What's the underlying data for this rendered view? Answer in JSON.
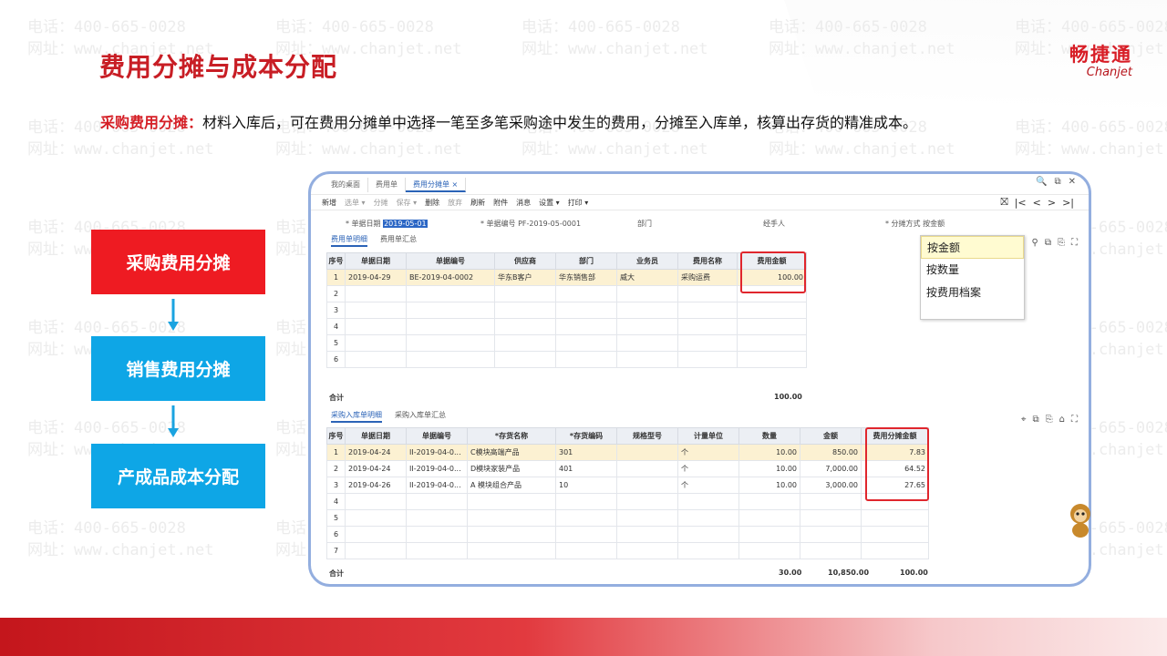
{
  "watermark": {
    "phone": "电话：400-665-0028",
    "site": "网址：www.chanjet.net"
  },
  "title": "费用分摊与成本分配",
  "logo": {
    "cn": "畅捷通",
    "en": "Chanjet"
  },
  "intro": {
    "label": "采购费用分摊：",
    "text": "材料入库后，可在费用分摊单中选择一笔至多笔采购途中发生的费用，分摊至入库单，核算出存货的精准成本。"
  },
  "flow": {
    "steps": [
      "采购费用分摊",
      "销售费用分摊",
      "产成品成本分配"
    ],
    "colors": [
      "#ee1b22",
      "#0ea6e6",
      "#0ea6e6"
    ]
  },
  "window": {
    "tabs": [
      "我的桌面",
      "费用单",
      "费用分摊单"
    ],
    "tab_close": "×",
    "toolbar": [
      {
        "label": "新增",
        "dim": false
      },
      {
        "label": "选单 ▾",
        "dim": true
      },
      {
        "label": "分摊",
        "dim": true
      },
      {
        "label": "保存 ▾",
        "dim": true
      },
      {
        "label": "删除",
        "dim": false
      },
      {
        "label": "放弃",
        "dim": true
      },
      {
        "label": "刷新",
        "dim": false
      },
      {
        "label": "附件",
        "dim": false
      },
      {
        "label": "消息",
        "dim": false
      },
      {
        "label": "设置 ▾",
        "dim": false
      },
      {
        "label": "打印 ▾",
        "dim": false
      }
    ],
    "nav_icons": [
      "⛝",
      "|<",
      "<",
      ">",
      ">|"
    ],
    "window_icons": [
      "🔍",
      "⧉",
      "✕"
    ],
    "form": {
      "date_label": "* 单据日期",
      "date_value": "2019-05-01",
      "code_label": "* 单据编号",
      "code_value": "PF-2019-05-0001",
      "dept_label": "部门",
      "handler_label": "经手人",
      "method_label": "* 分摊方式",
      "method_value": "按金额"
    },
    "top_subtabs": [
      "费用单明细",
      "费用单汇总"
    ],
    "expense_table": {
      "headers": [
        "序号",
        "单据日期",
        "单据编号",
        "供应商",
        "部门",
        "业务员",
        "费用名称",
        "费用金额"
      ],
      "rows": [
        [
          "1",
          "2019-04-29",
          "BE-2019-04-0002",
          "华东B客户",
          "华东销售部",
          "威大",
          "采购运费",
          "100.00"
        ]
      ],
      "empty_rows": [
        "2",
        "3",
        "4",
        "5",
        "6"
      ],
      "sum_label": "合计",
      "sum_value": "100.00"
    },
    "dropdown": [
      "按金额",
      "按数量",
      "按费用档案"
    ],
    "bottom_subtabs": [
      "采购入库单明细",
      "采购入库单汇总"
    ],
    "receipt_table": {
      "headers": [
        "序号",
        "单据日期",
        "单据编号",
        "*存货名称",
        "*存货编码",
        "规格型号",
        "计量单位",
        "数量",
        "金额",
        "费用分摊金额"
      ],
      "rows": [
        [
          "1",
          "2019-04-24",
          "II-2019-04-0...",
          "C模块高端产品",
          "301",
          "",
          "个",
          "10.00",
          "850.00",
          "7.83"
        ],
        [
          "2",
          "2019-04-24",
          "II-2019-04-0...",
          "D模块家装产品",
          "401",
          "",
          "个",
          "10.00",
          "7,000.00",
          "64.52"
        ],
        [
          "3",
          "2019-04-26",
          "II-2019-04-0...",
          "A 模块组合产品",
          "10",
          "",
          "个",
          "10.00",
          "3,000.00",
          "27.65"
        ]
      ],
      "empty_rows": [
        "4",
        "5",
        "6",
        "7"
      ],
      "sum_label": "合计",
      "sum_qty": "30.00",
      "sum_amount": "10,850.00",
      "sum_alloc": "100.00"
    }
  }
}
